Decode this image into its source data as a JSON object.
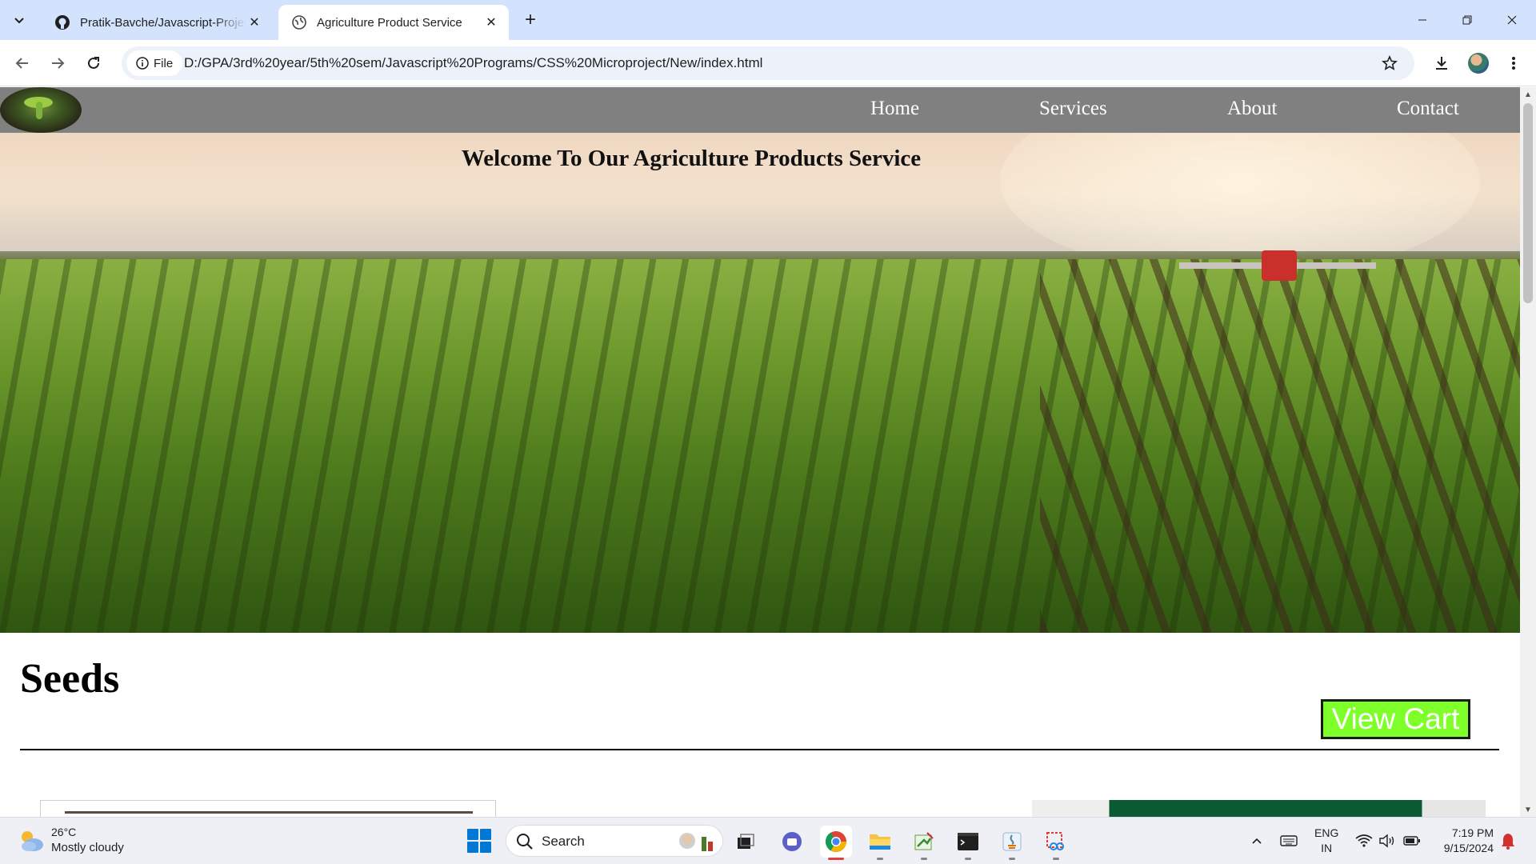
{
  "browser": {
    "tabs": [
      {
        "title": "Pratik-Bavche/Javascript-Projects",
        "active": false,
        "icon": "github-icon"
      },
      {
        "title": "Agriculture Product Service",
        "active": true,
        "icon": "globe-icon"
      }
    ],
    "new_tab_label": "+",
    "address": {
      "chip_label": "File",
      "url": "D:/GPA/3rd%20year/5th%20sem/Javascript%20Programs/CSS%20Microproject/New/index.html"
    }
  },
  "site": {
    "nav": [
      "Home",
      "Services",
      "About",
      "Contact"
    ],
    "hero_title": "Welcome To Our Agriculture Products Service",
    "section_title": "Seeds",
    "view_cart_label": "View Cart",
    "colors": {
      "nav_bg": "#808080",
      "view_cart_bg": "#7fff2a"
    }
  },
  "taskbar": {
    "weather": {
      "temp": "26°C",
      "desc": "Mostly cloudy"
    },
    "search_label": "Search",
    "language": {
      "line1": "ENG",
      "line2": "IN"
    },
    "clock": {
      "time": "7:19 PM",
      "date": "9/15/2024"
    }
  }
}
